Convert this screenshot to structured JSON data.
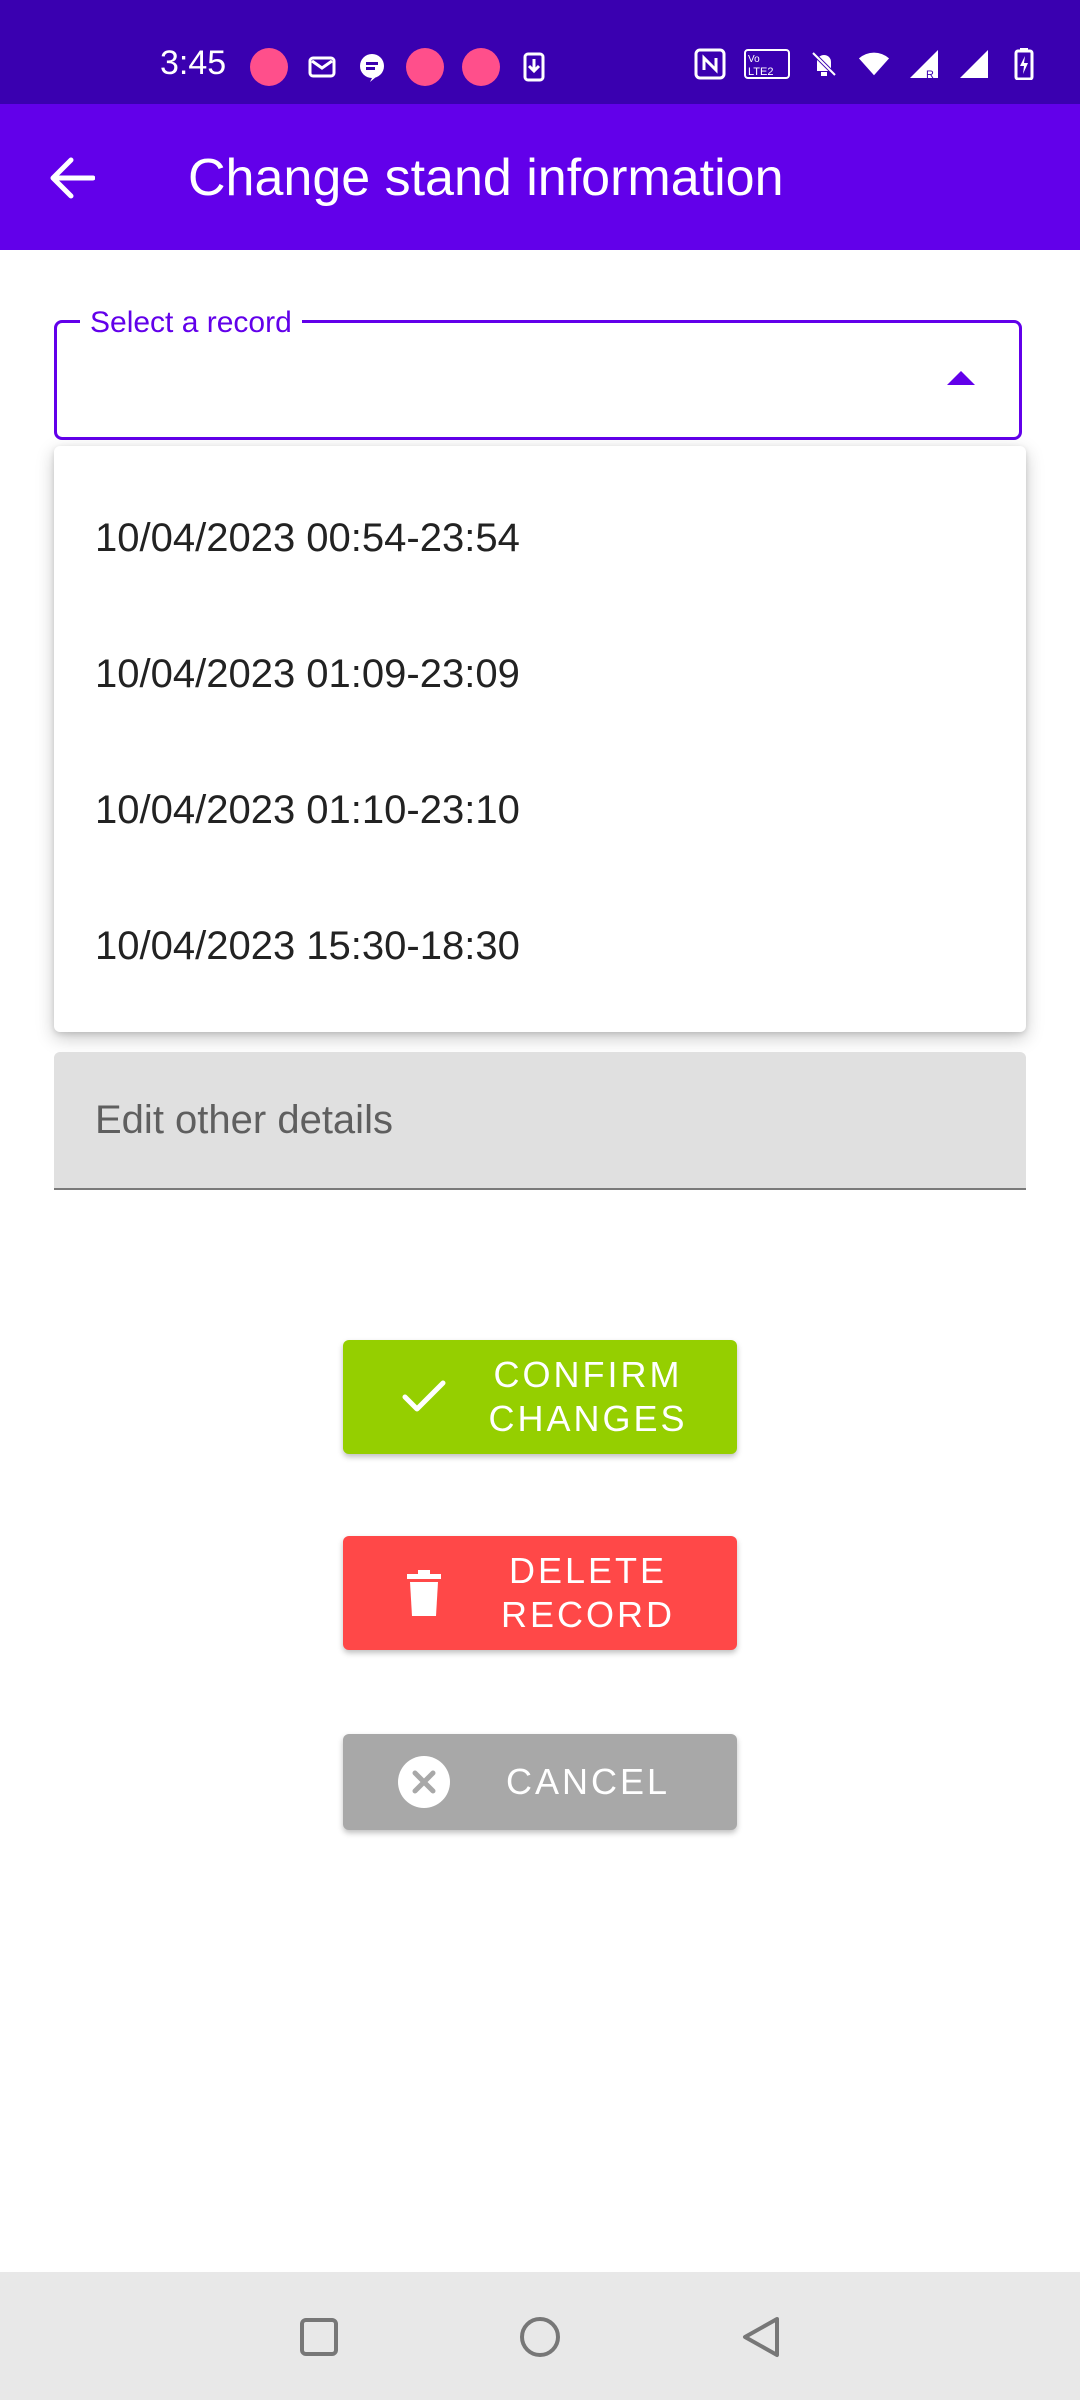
{
  "status_bar": {
    "time": "3:45",
    "left_icons": [
      "app-notification-icon",
      "mail-icon",
      "message-icon",
      "app-notification-icon",
      "app-notification-icon",
      "download-icon"
    ],
    "right_icons": [
      "nfc-icon",
      "volte-icon",
      "mute-icon",
      "wifi-icon",
      "signal-roaming-icon",
      "signal-icon",
      "battery-charging-icon"
    ],
    "volte_text": "Vo LTE2"
  },
  "app_bar": {
    "title": "Change stand information"
  },
  "select": {
    "label": "Select a record",
    "value": ""
  },
  "dropdown": {
    "options": [
      "10/04/2023 00:54-23:54",
      "10/04/2023 01:09-23:09",
      "10/04/2023 01:10-23:10",
      "10/04/2023 15:30-18:30"
    ]
  },
  "details": {
    "placeholder": "Edit other details"
  },
  "buttons": {
    "confirm_line1": "CONFIRM",
    "confirm_line2": "CHANGES",
    "delete_line1": "DELETE",
    "delete_line2": "RECORD",
    "cancel": "CANCEL"
  },
  "colors": {
    "status_bar": "#3a00b0",
    "app_bar": "#6200ea",
    "confirm": "#95cf00",
    "delete": "#ff4848",
    "cancel": "#a8a8a8"
  }
}
